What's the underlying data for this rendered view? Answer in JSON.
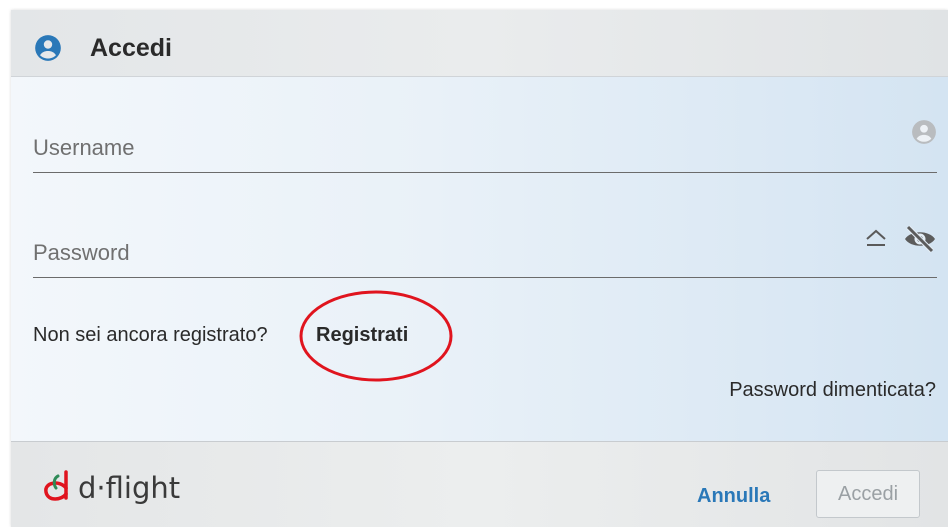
{
  "dialog": {
    "title": "Accedi",
    "header_icon": "account-circle-icon"
  },
  "form": {
    "username": {
      "label": "Username",
      "value": "",
      "icon": "account-circle-icon"
    },
    "password": {
      "label": "Password",
      "value": "",
      "caps_icon": "caps-lock-icon",
      "visibility_icon": "eye-off-icon"
    },
    "register": {
      "prompt": "Non sei ancora registrato?",
      "link_label": "Registrati"
    },
    "forgot_label": "Password dimenticata?"
  },
  "footer": {
    "logo_text": "d·flight",
    "cancel_label": "Annulla",
    "submit_label": "Accedi"
  },
  "colors": {
    "accent": "#2a78b8",
    "annotation": "#e0141e",
    "logo_red": "#e0141e",
    "logo_green": "#2e8b57"
  }
}
